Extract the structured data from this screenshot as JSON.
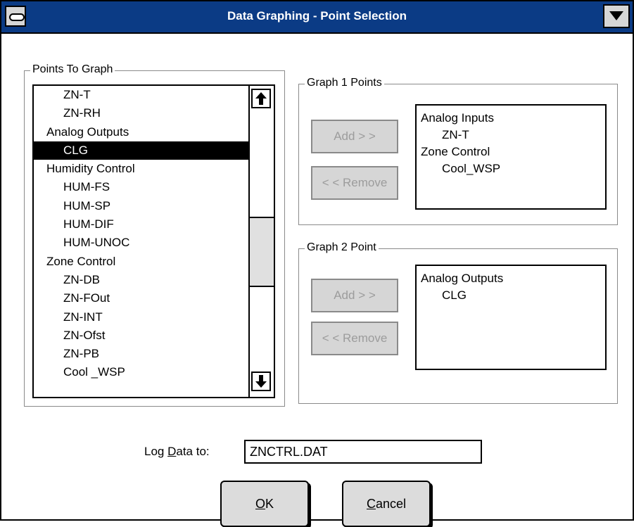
{
  "window": {
    "title": "Data Graphing - Point Selection"
  },
  "points_to_graph": {
    "label": "Points To Graph",
    "items": [
      {
        "text": "ZN-T",
        "level": "sub"
      },
      {
        "text": "ZN-RH",
        "level": "sub"
      },
      {
        "text": "Analog Outputs",
        "level": "hdr"
      },
      {
        "text": "CLG",
        "level": "sub",
        "selected": true
      },
      {
        "text": "Humidity Control",
        "level": "hdr"
      },
      {
        "text": "HUM-FS",
        "level": "sub"
      },
      {
        "text": "HUM-SP",
        "level": "sub"
      },
      {
        "text": "HUM-DIF",
        "level": "sub"
      },
      {
        "text": "HUM-UNOC",
        "level": "sub"
      },
      {
        "text": "Zone Control",
        "level": "hdr"
      },
      {
        "text": "ZN-DB",
        "level": "sub"
      },
      {
        "text": "ZN-FOut",
        "level": "sub"
      },
      {
        "text": "ZN-INT",
        "level": "sub"
      },
      {
        "text": "ZN-Ofst",
        "level": "sub"
      },
      {
        "text": "ZN-PB",
        "level": "sub"
      },
      {
        "text": "Cool _WSP",
        "level": "sub"
      }
    ]
  },
  "graph1": {
    "label": "Graph 1 Points",
    "add_label": "Add > >",
    "remove_label": "< < Remove",
    "items": [
      {
        "text": "Analog Inputs",
        "level": "hdr"
      },
      {
        "text": "ZN-T",
        "level": "sub"
      },
      {
        "text": "Zone Control",
        "level": "hdr"
      },
      {
        "text": "Cool_WSP",
        "level": "sub"
      }
    ]
  },
  "graph2": {
    "label": "Graph 2 Point",
    "add_label": "Add > >",
    "remove_label": "< < Remove",
    "items": [
      {
        "text": "Analog Outputs",
        "level": "hdr"
      },
      {
        "text": "CLG",
        "level": "sub"
      }
    ]
  },
  "log": {
    "label_prefix": "Log ",
    "label_mnemonic": "D",
    "label_suffix": "ata to:",
    "value": "ZNCTRL.DAT"
  },
  "buttons": {
    "ok_mnemonic": "O",
    "ok_rest": "K",
    "cancel_mnemonic": "C",
    "cancel_rest": "ancel"
  },
  "colors": {
    "titlebar": "#0b3b85",
    "button_face": "#d6d6d6",
    "disabled_text": "#9c9c9c",
    "selection": "#000000"
  }
}
